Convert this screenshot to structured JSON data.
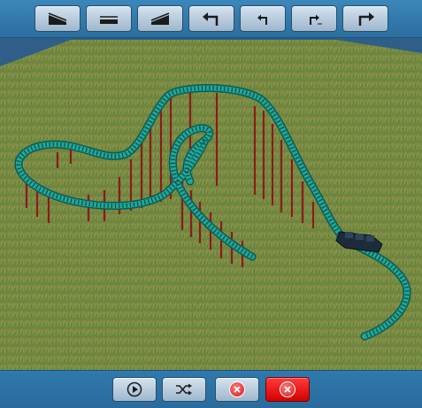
{
  "toolbar_top": {
    "buttons": [
      {
        "id": "slope-down",
        "icon": "slope-down-icon"
      },
      {
        "id": "straight",
        "icon": "straight-track-icon"
      },
      {
        "id": "slope-up",
        "icon": "slope-up-icon"
      },
      {
        "id": "turn-left-large",
        "icon": "turn-left-large-icon"
      },
      {
        "id": "turn-left-small",
        "icon": "turn-left-small-icon"
      },
      {
        "id": "turn-right-small",
        "icon": "turn-right-small-icon"
      },
      {
        "id": "turn-right-large",
        "icon": "turn-right-large-icon"
      }
    ]
  },
  "toolbar_bottom": {
    "buttons": [
      {
        "id": "play",
        "icon": "play-icon"
      },
      {
        "id": "shuffle",
        "icon": "shuffle-icon"
      },
      {
        "id": "remove-piece",
        "icon": "remove-icon"
      },
      {
        "id": "delete-all",
        "icon": "delete-icon",
        "color": "#ff0000"
      }
    ]
  },
  "scene": {
    "ground_color": "#6f8a3f",
    "track_color": "#1fa89a",
    "support_color": "#8b1c1c",
    "car_color": "#1d2c3c"
  }
}
